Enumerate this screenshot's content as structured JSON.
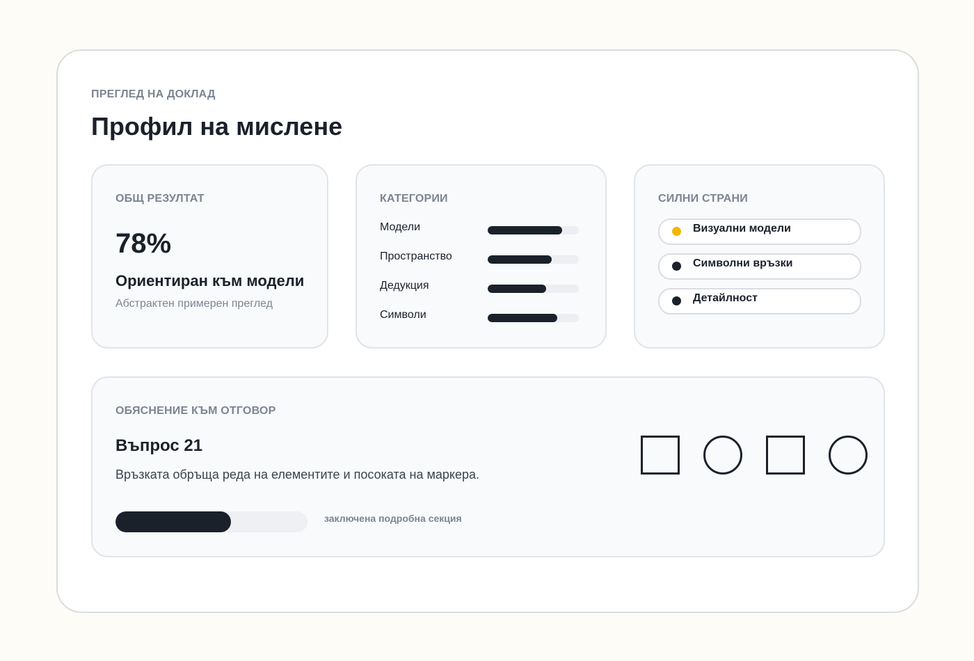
{
  "header": {
    "overline": "ПРЕГЛЕД НА ДОКЛАД",
    "title": "Профил на мислене"
  },
  "overall": {
    "label": "ОБЩ РЕЗУЛТАТ",
    "score": "78%",
    "profile": "Ориентиран към модели",
    "note": "Абстрактен примерен преглед"
  },
  "categories": {
    "label": "КАТЕГОРИИ",
    "items": [
      {
        "label": "Модели",
        "value": 0.82
      },
      {
        "label": "Пространство",
        "value": 0.7
      },
      {
        "label": "Дедукция",
        "value": 0.64
      },
      {
        "label": "Символи",
        "value": 0.76
      }
    ]
  },
  "strengths": {
    "label": "СИЛНИ СТРАНИ",
    "items": [
      {
        "label": "Визуални модели",
        "dot_color": "#f2b705"
      },
      {
        "label": "Символни връзки",
        "dot_color": "#1b212b"
      },
      {
        "label": "Детайлност",
        "dot_color": "#1b212b"
      }
    ]
  },
  "explanation": {
    "label": "ОБЯСНЕНИЕ КЪМ ОТГОВОР",
    "question": "Въпрос 21",
    "text": "Връзката обръща реда на елементите и посоката на маркера.",
    "progress": 0.6,
    "progress_label": "заключена подробна секция",
    "shapes": [
      "square",
      "circle",
      "square",
      "circle"
    ]
  },
  "colors": {
    "accent": "#f2b705",
    "ink": "#1b212b",
    "muted": "#7c8591",
    "background": "#fdfcf6"
  }
}
